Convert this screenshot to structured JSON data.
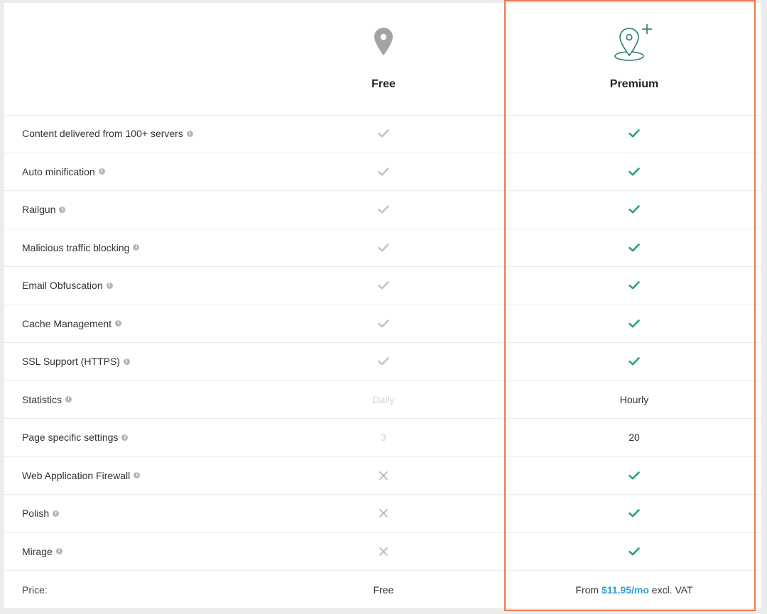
{
  "plans": {
    "free": {
      "title": "Free",
      "icon": "map-pin-icon"
    },
    "premium": {
      "title": "Premium",
      "icon": "map-pin-plus-icon"
    }
  },
  "features": [
    {
      "name": "Content delivered from 100+ servers",
      "free": "check",
      "premium": "check"
    },
    {
      "name": "Auto minification",
      "free": "check",
      "premium": "check"
    },
    {
      "name": "Railgun",
      "free": "check",
      "premium": "check"
    },
    {
      "name": "Malicious traffic blocking",
      "free": "check",
      "premium": "check"
    },
    {
      "name": "Email Obfuscation",
      "free": "check",
      "premium": "check"
    },
    {
      "name": "Cache Management",
      "free": "check",
      "premium": "check"
    },
    {
      "name": "SSL Support (HTTPS)",
      "free": "check",
      "premium": "check"
    },
    {
      "name": "Statistics",
      "free_text": "Daily",
      "premium_text": "Hourly"
    },
    {
      "name": "Page specific settings",
      "free_text": "3",
      "premium_text": "20"
    },
    {
      "name": "Web Application Firewall",
      "free": "cross",
      "premium": "check"
    },
    {
      "name": "Polish",
      "free": "cross",
      "premium": "check"
    },
    {
      "name": "Mirage",
      "free": "cross",
      "premium": "check"
    }
  ],
  "info_glyph": "i",
  "price": {
    "label": "Price:",
    "free": "Free",
    "premium_prefix": "From",
    "premium_amount": "$11.95/mo",
    "premium_suffix": "excl. VAT"
  },
  "colors": {
    "accent_border": "#ec7a4b",
    "check_premium": "#1fa67a",
    "check_free": "#c4c4c4",
    "price_link": "#2aa3d8"
  }
}
